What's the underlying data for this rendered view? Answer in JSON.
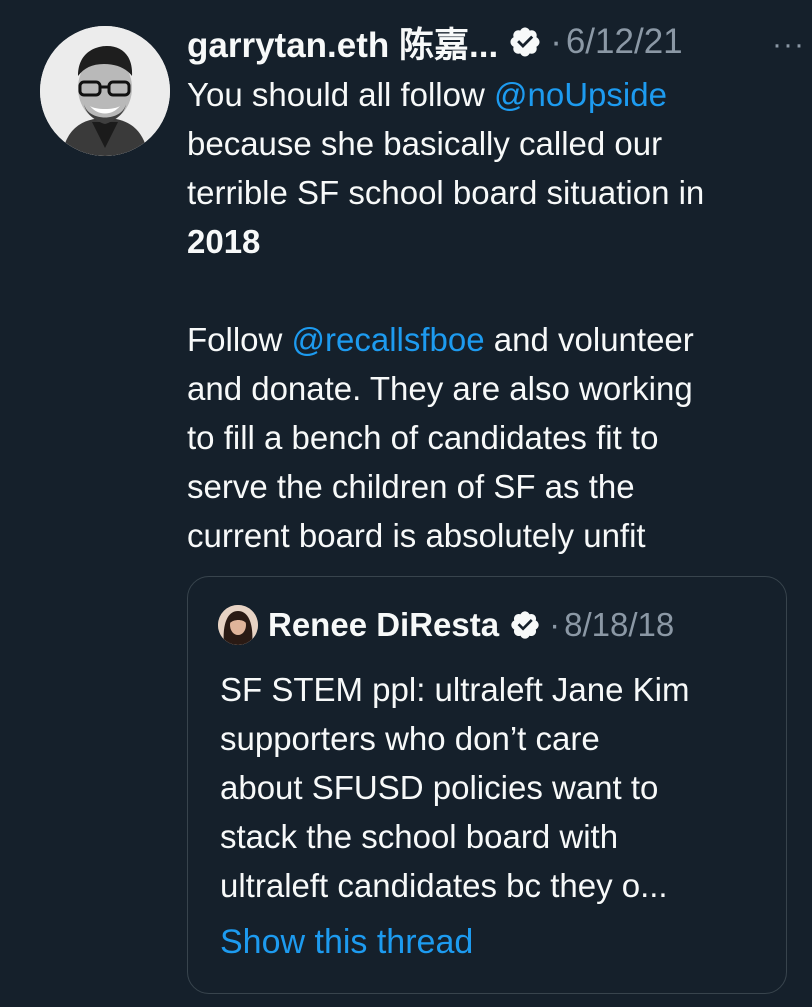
{
  "tweet": {
    "author_name": "garrytan.eth 陈嘉...",
    "dot": "·",
    "date": "6/12/21",
    "more": "···",
    "line1_prefix": "You should all follow ",
    "line1_mention": "@noUpside",
    "line2": "because she basically called our",
    "line3": "terrible SF school board situation in",
    "line4_bold": "2018",
    "line6_prefix": "Follow ",
    "line6_mention": "@recallsfboe",
    "line6_suffix": " and volunteer",
    "line7": "and donate. They are also working",
    "line8": "to fill a bench of candidates fit to",
    "line9": "serve the children of SF as the",
    "line10": "current board is absolutely unfit"
  },
  "quote": {
    "author_name": "Renee DiResta",
    "dot": "·",
    "date": "8/18/18",
    "lines": [
      "SF STEM ppl: ultraleft Jane Kim",
      "supporters who don’t care",
      "about SFUSD policies want to",
      "stack the school board with",
      "ultraleft candidates bc they o..."
    ],
    "show_thread": "Show this thread"
  },
  "colors": {
    "background": "#15202b",
    "text": "#f7f9f9",
    "secondary": "#8b98a5",
    "accent": "#1d9bf0",
    "border": "#38444d"
  },
  "icons": {
    "verified": "verified-badge-icon",
    "more": "more-options-icon"
  }
}
